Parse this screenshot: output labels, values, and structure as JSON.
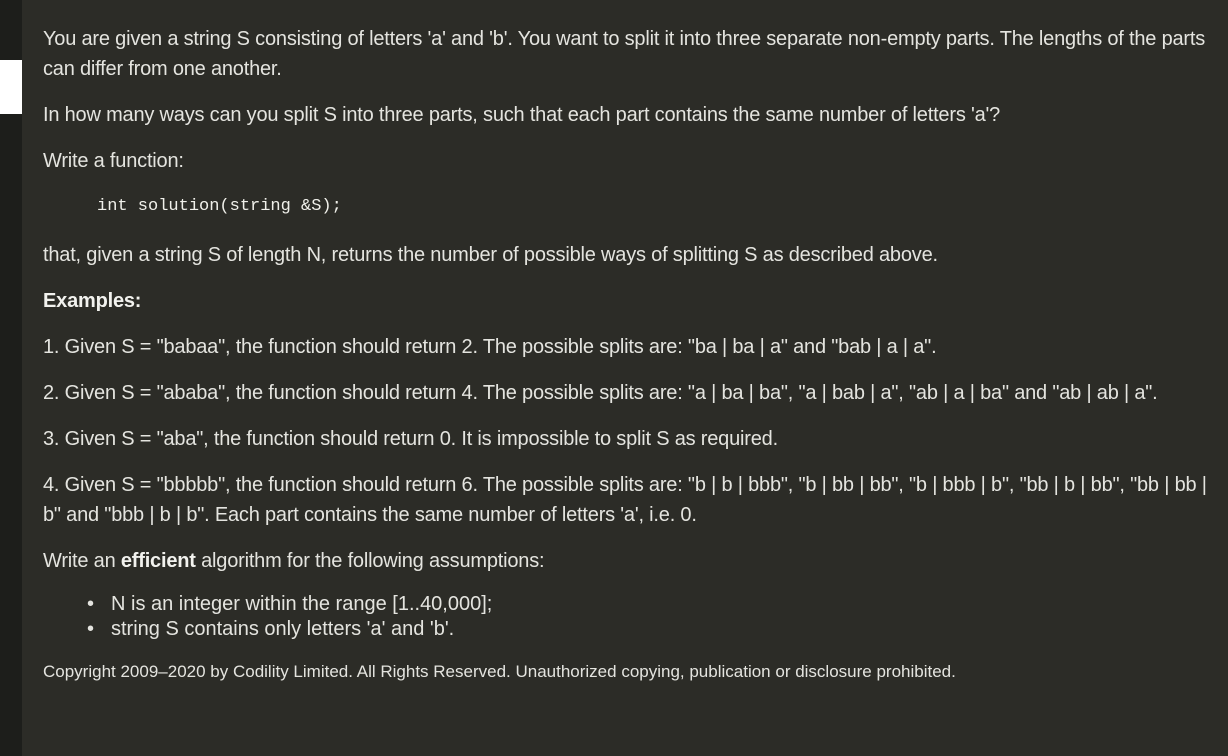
{
  "task": {
    "intro": "You are given a string S consisting of letters 'a' and 'b'. You want to split it into three separate non-empty parts. The lengths of the parts can differ from one another.",
    "question": "In how many ways can you split S into three parts, such that each part contains the same number of letters 'a'?",
    "write_function": "Write a function:",
    "signature": "int solution(string &S);",
    "returns": "that, given a string S of length N, returns the number of possible ways of splitting S as described above.",
    "examples_heading": "Examples:",
    "examples": [
      "1. Given S = \"babaa\", the function should return 2. The possible splits are: \"ba | ba | a\" and \"bab | a | a\".",
      "2. Given S = \"ababa\", the function should return 4. The possible splits are: \"a | ba | ba\", \"a | bab | a\", \"ab | a | ba\" and \"ab | ab | a\".",
      "3. Given S = \"aba\", the function should return 0. It is impossible to split S as required.",
      "4. Given S = \"bbbbb\", the function should return 6. The possible splits are: \"b | b | bbb\", \"b | bb | bb\", \"b | bbb | b\", \"bb | b | bb\", \"bb | bb | b\" and \"bbb | b | b\". Each part contains the same number of letters 'a', i.e. 0."
    ],
    "efficiency_pre": "Write an ",
    "efficiency_bold": "efficient",
    "efficiency_post": " algorithm for the following assumptions:",
    "bullet_glyph": "•",
    "assumptions": [
      "N is an integer within the range [1..40,000];",
      "string S contains only letters 'a' and 'b'."
    ],
    "copyright": "Copyright 2009–2020 by Codility Limited. All Rights Reserved. Unauthorized copying, publication or disclosure prohibited."
  }
}
